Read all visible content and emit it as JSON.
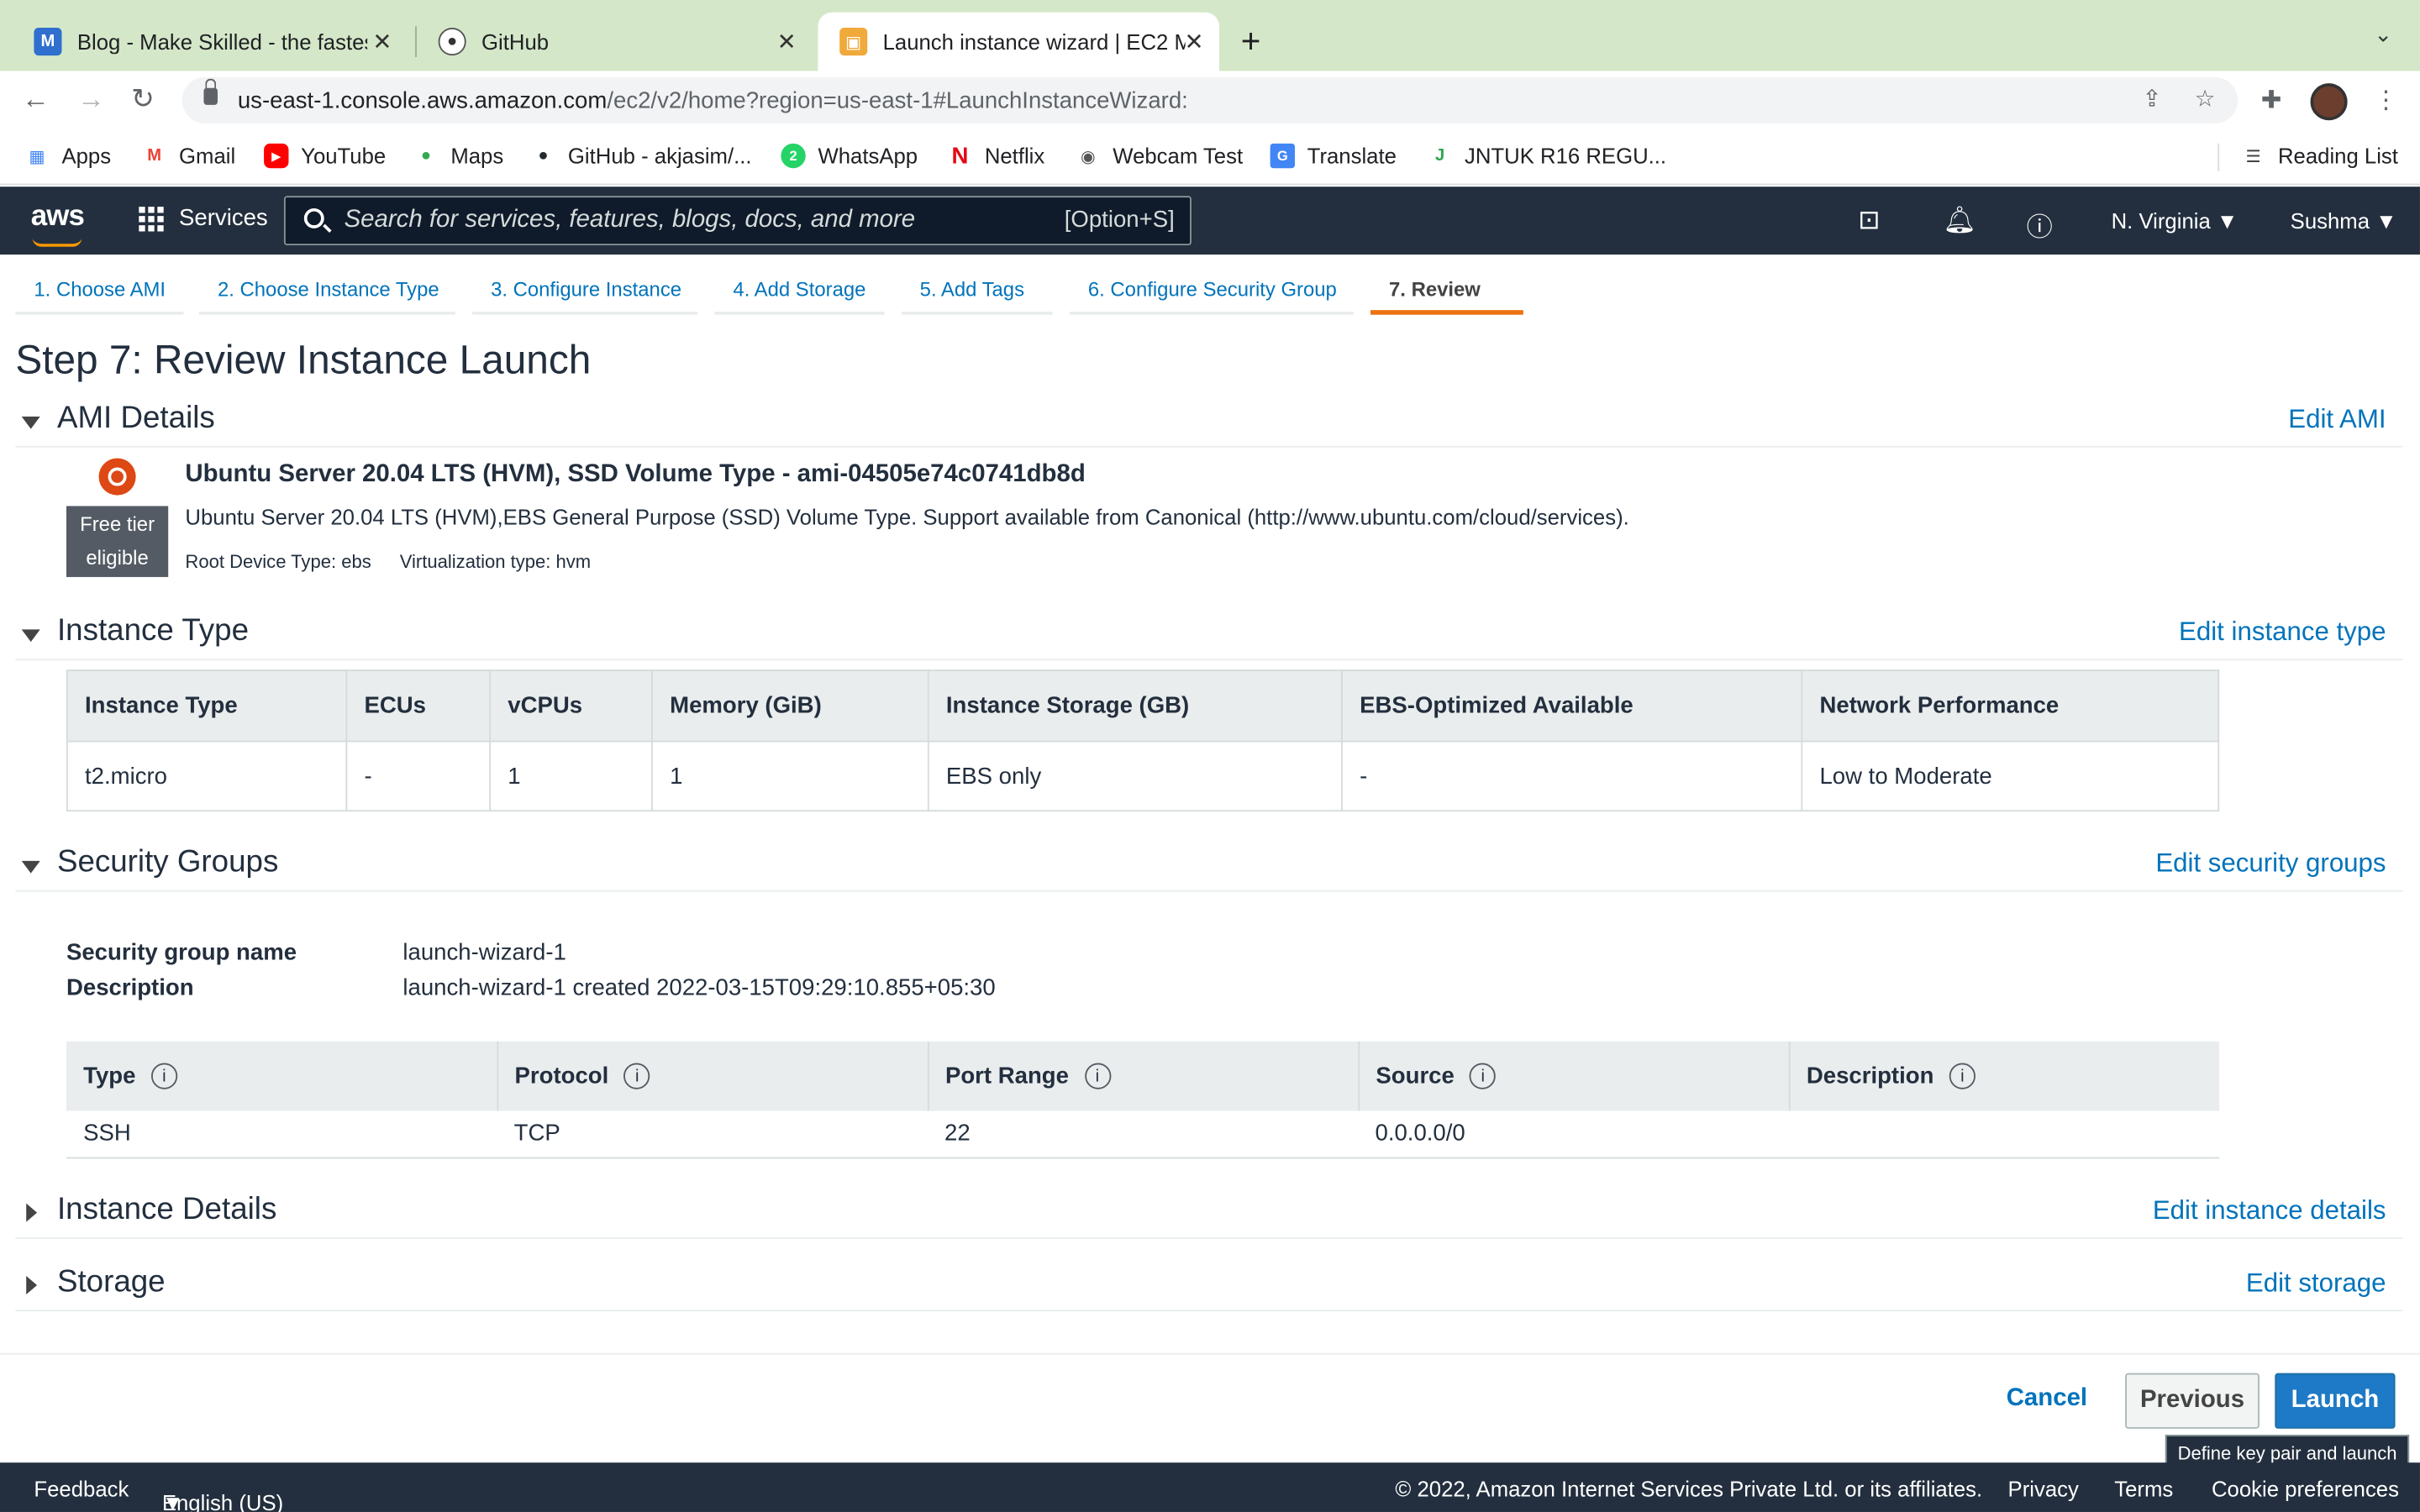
{
  "browser": {
    "tabs": [
      {
        "title": "Blog - Make Skilled - the fastest",
        "favicon": "M"
      },
      {
        "title": "GitHub",
        "favicon": "github-icon"
      },
      {
        "title": "Launch instance wizard | EC2 M",
        "favicon": "aws-box-icon"
      }
    ],
    "url_host": "us-east-1.console.aws.amazon.com",
    "url_path": "/ec2/v2/home?region=us-east-1#LaunchInstanceWizard:",
    "bookmarks": [
      {
        "label": "Apps",
        "icon": "apps-grid-icon"
      },
      {
        "label": "Gmail",
        "icon": "gmail-icon"
      },
      {
        "label": "YouTube",
        "icon": "youtube-icon"
      },
      {
        "label": "Maps",
        "icon": "maps-pin-icon"
      },
      {
        "label": "GitHub - akjasim/...",
        "icon": "github-icon"
      },
      {
        "label": "WhatsApp",
        "icon": "whatsapp-icon"
      },
      {
        "label": "Netflix",
        "icon": "netflix-icon"
      },
      {
        "label": "Webcam Test",
        "icon": "webcam-icon"
      },
      {
        "label": "Translate",
        "icon": "translate-icon"
      },
      {
        "label": "JNTUK R16 REGU...",
        "icon": "jntuk-icon"
      }
    ],
    "reading_list": "Reading List"
  },
  "aws_header": {
    "logo": "aws",
    "services": "Services",
    "search_placeholder": "Search for services, features, blogs, docs, and more",
    "search_shortcut": "[Option+S]",
    "region": "N. Virginia",
    "user": "Sushma"
  },
  "wizard": {
    "steps": [
      "1. Choose AMI",
      "2. Choose Instance Type",
      "3. Configure Instance",
      "4. Add Storage",
      "5. Add Tags",
      "6. Configure Security Group",
      "7. Review"
    ],
    "active_step": 7,
    "title": "Step 7: Review Instance Launch"
  },
  "ami": {
    "section": "AMI Details",
    "edit": "Edit AMI",
    "name": "Ubuntu Server 20.04 LTS (HVM), SSD Volume Type - ami-04505e74c0741db8d",
    "description": "Ubuntu Server 20.04 LTS (HVM),EBS General Purpose (SSD) Volume Type. Support available from Canonical (http://www.ubuntu.com/cloud/services).",
    "free_tier_line1": "Free tier",
    "free_tier_line2": "eligible",
    "root_device": "Root Device Type: ebs",
    "virtualization": "Virtualization type: hvm"
  },
  "instance_type": {
    "section": "Instance Type",
    "edit": "Edit instance type",
    "headers": [
      "Instance Type",
      "ECUs",
      "vCPUs",
      "Memory (GiB)",
      "Instance Storage (GB)",
      "EBS-Optimized Available",
      "Network Performance"
    ],
    "row": [
      "t2.micro",
      "-",
      "1",
      "1",
      "EBS only",
      "-",
      "Low to Moderate"
    ]
  },
  "security_groups": {
    "section": "Security Groups",
    "edit": "Edit security groups",
    "name_label": "Security group name",
    "name_value": "launch-wizard-1",
    "desc_label": "Description",
    "desc_value": "launch-wizard-1 created 2022-03-15T09:29:10.855+05:30",
    "headers": [
      "Type",
      "Protocol",
      "Port Range",
      "Source",
      "Description"
    ],
    "row": [
      "SSH",
      "TCP",
      "22",
      "0.0.0.0/0",
      ""
    ]
  },
  "instance_details": {
    "section": "Instance Details",
    "edit": "Edit instance details"
  },
  "storage": {
    "section": "Storage",
    "edit": "Edit storage"
  },
  "actions": {
    "cancel": "Cancel",
    "previous": "Previous",
    "launch": "Launch",
    "launch_tooltip": "Define key pair and launch"
  },
  "footer": {
    "feedback": "Feedback",
    "language": "English (US)",
    "copyright": "© 2022, Amazon Internet Services Private Ltd. or its affiliates.",
    "privacy": "Privacy",
    "terms": "Terms",
    "cookies": "Cookie preferences"
  },
  "colors": {
    "aws_header": "#232f3e",
    "link": "#0073bb",
    "active_step": "#ec7211",
    "launch_button": "#1e7ac6",
    "tab_strip": "#d4e8c9"
  }
}
